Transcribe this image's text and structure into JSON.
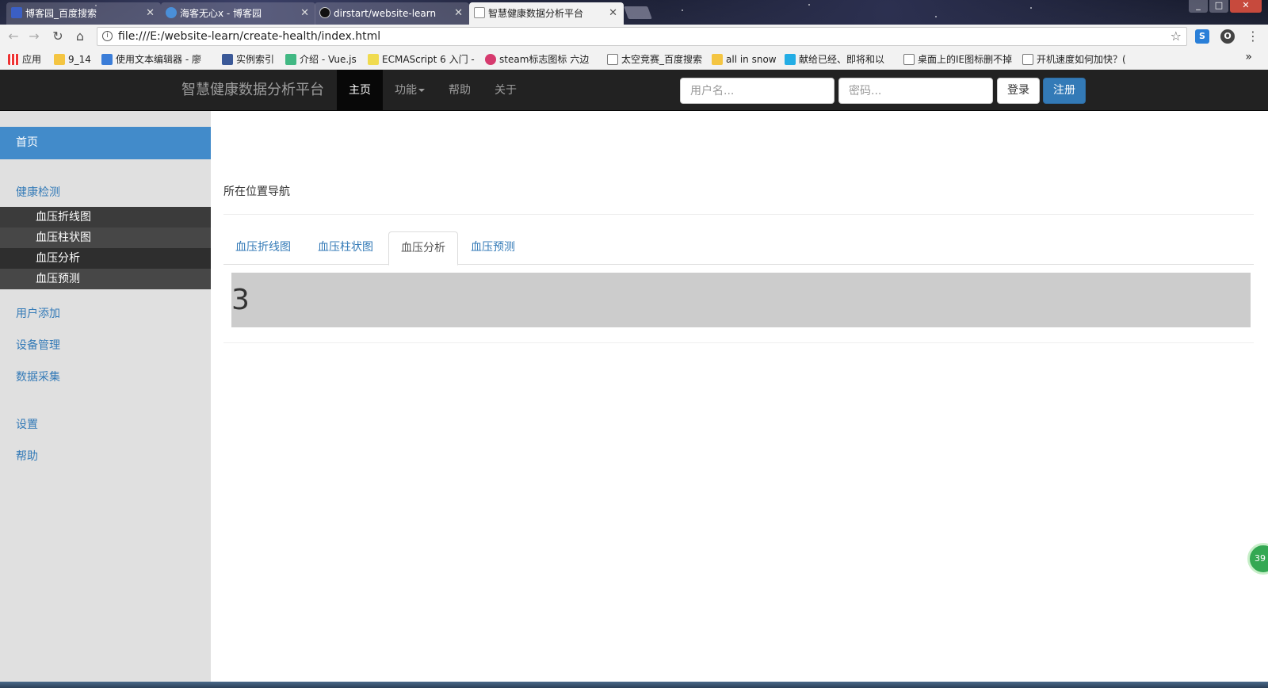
{
  "browser": {
    "tabs": [
      {
        "title": "博客园_百度搜索",
        "active": false
      },
      {
        "title": "海客无心x - 博客园",
        "active": false
      },
      {
        "title": "dirstart/website-learn",
        "active": false
      },
      {
        "title": "智慧健康数据分析平台",
        "active": true
      }
    ],
    "url": "file:///E:/website-learn/create-health/index.html",
    "bookmarks": [
      "应用",
      "9_14",
      "使用文本编辑器 - 廖",
      "实例索引",
      "介绍 - Vue.js",
      "ECMAScript 6 入门 -",
      "steam标志图标 六边",
      "太空竞赛_百度搜索",
      "all in snow",
      "献给已经、即将和以",
      "桌面上的IE图标删不掉",
      "开机速度如何加快？("
    ],
    "more_bookmarks": "»"
  },
  "navbar": {
    "brand": "智慧健康数据分析平台",
    "items": [
      "主页",
      "功能",
      "帮助",
      "关于"
    ],
    "username_placeholder": "用户名...",
    "password_placeholder": "密码...",
    "login_label": "登录",
    "register_label": "注册"
  },
  "sidebar": {
    "home": "首页",
    "health": "健康检测",
    "sub_items": [
      "血压折线图",
      "血压柱状图",
      "血压分析",
      "血压预测"
    ],
    "user_add": "用户添加",
    "device": "设备管理",
    "data": "数据采集",
    "settings": "设置",
    "help": "帮助"
  },
  "main": {
    "breadcrumb": "所在位置导航",
    "tabs": [
      "血压折线图",
      "血压柱状图",
      "血压分析",
      "血压预测"
    ],
    "active_tab": 2,
    "panel_text": "3"
  },
  "badge": "39"
}
